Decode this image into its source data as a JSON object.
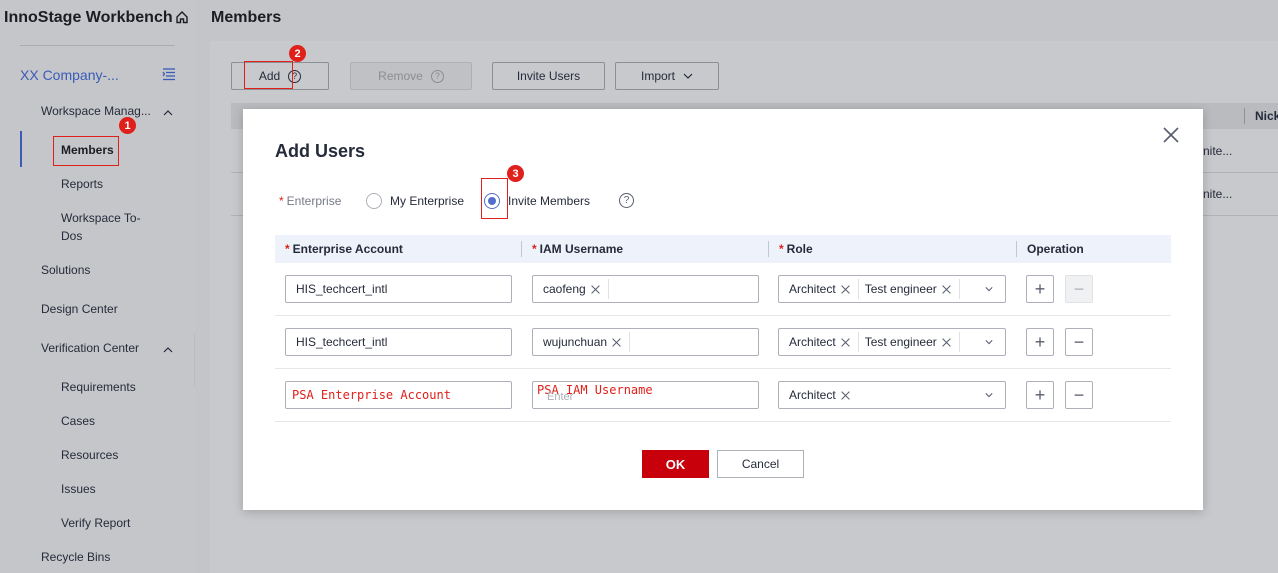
{
  "sidebar": {
    "brand": "InnoStage Workbench",
    "company": "XX Company-...",
    "items": {
      "workspace": "Workspace Manag...",
      "members": "Members",
      "reports": "Reports",
      "todos": "Workspace To-Dos",
      "solutions": "Solutions",
      "design": "Design Center",
      "verification": "Verification Center",
      "requirements": "Requirements",
      "cases": "Cases",
      "resources": "Resources",
      "issues": "Issues",
      "verify_report": "Verify Report",
      "recycle": "Recycle Bins"
    }
  },
  "main": {
    "title": "Members",
    "toolbar": {
      "add": "Add",
      "remove": "Remove",
      "invite": "Invite Users",
      "import": "Import"
    },
    "table": {
      "col_nick": "Nick",
      "row1_trail": "nite...",
      "row2_trail": "nite..."
    }
  },
  "annotations": {
    "badge1": "1",
    "badge2": "2",
    "badge3": "3"
  },
  "modal": {
    "title": "Add Users",
    "enterprise_label": "Enterprise",
    "req_mark": "*",
    "option_my": "My Enterprise",
    "option_invite": "Invite Members",
    "help": "?",
    "columns": {
      "account": "Enterprise Account",
      "iam": "IAM Username",
      "role": "Role",
      "operation": "Operation"
    },
    "rows": [
      {
        "account": "HIS_techcert_intl",
        "iam": "caofeng",
        "roles": [
          "Architect",
          "Test engineer"
        ]
      },
      {
        "account": "HIS_techcert_intl",
        "iam": "wujunchuan",
        "roles": [
          "Architect",
          "Test engineer"
        ]
      },
      {
        "account": "PSA Enterprise Account",
        "iam": "PSA IAM Username",
        "iam_placeholder": "Enter",
        "roles": [
          "Architect"
        ]
      }
    ],
    "plus": "+",
    "minus": "−",
    "ok": "OK",
    "cancel": "Cancel"
  },
  "colors": {
    "accent": "#526ecc",
    "danger": "#c7000b",
    "annotation": "#e0201a"
  }
}
